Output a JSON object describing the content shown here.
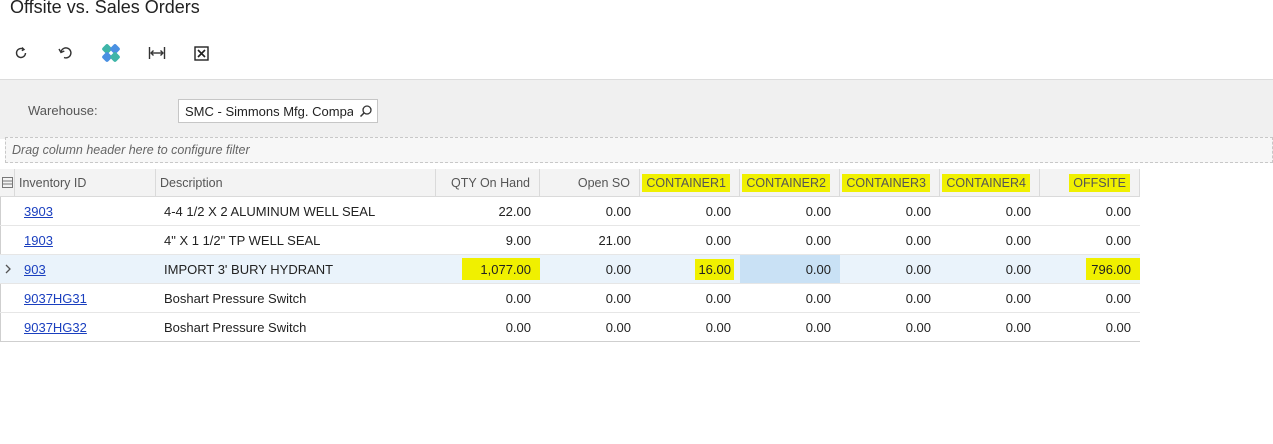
{
  "page": {
    "title": "Offsite vs. Sales Orders"
  },
  "toolbar": {
    "buttons": [
      {
        "name": "refresh-button",
        "icon": "refresh-icon"
      },
      {
        "name": "undo-button",
        "icon": "undo-icon"
      },
      {
        "name": "power-bi-button",
        "icon": "puzzle-icon"
      },
      {
        "name": "fit-columns-button",
        "icon": "fit-width-icon"
      },
      {
        "name": "export-excel-button",
        "icon": "excel-icon"
      }
    ]
  },
  "filter": {
    "warehouse_label": "Warehouse:",
    "warehouse_value": "SMC - Simmons Mfg. Compa"
  },
  "drag_hint": "Drag column header here to configure filter",
  "grid": {
    "columns": [
      {
        "key": "inventory_id",
        "label": "Inventory ID"
      },
      {
        "key": "description",
        "label": "Description"
      },
      {
        "key": "qty_on_hand",
        "label": "QTY On Hand"
      },
      {
        "key": "open_so",
        "label": "Open SO"
      },
      {
        "key": "container1",
        "label": "CONTAINER1"
      },
      {
        "key": "container2",
        "label": "CONTAINER2"
      },
      {
        "key": "container3",
        "label": "CONTAINER3"
      },
      {
        "key": "container4",
        "label": "CONTAINER4"
      },
      {
        "key": "offsite",
        "label": "OFFSITE"
      }
    ],
    "rows": [
      {
        "inventory_id": "3903",
        "description": "4-4 1/2 X 2 ALUMINUM WELL SEAL",
        "qty_on_hand": "22.00",
        "open_so": "0.00",
        "container1": "0.00",
        "container2": "0.00",
        "container3": "0.00",
        "container4": "0.00",
        "offsite": "0.00"
      },
      {
        "inventory_id": "1903",
        "description": "4\" X 1 1/2\" TP WELL SEAL",
        "qty_on_hand": "9.00",
        "open_so": "21.00",
        "container1": "0.00",
        "container2": "0.00",
        "container3": "0.00",
        "container4": "0.00",
        "offsite": "0.00"
      },
      {
        "inventory_id": "903",
        "description": "IMPORT 3' BURY HYDRANT",
        "qty_on_hand": "1,077.00",
        "open_so": "0.00",
        "container1": "16.00",
        "container2": "0.00",
        "container3": "0.00",
        "container4": "0.00",
        "offsite": "796.00"
      },
      {
        "inventory_id": "9037HG31",
        "description": "Boshart Pressure Switch",
        "qty_on_hand": "0.00",
        "open_so": "0.00",
        "container1": "0.00",
        "container2": "0.00",
        "container3": "0.00",
        "container4": "0.00",
        "offsite": "0.00"
      },
      {
        "inventory_id": "9037HG32",
        "description": "Boshart Pressure Switch",
        "qty_on_hand": "0.00",
        "open_so": "0.00",
        "container1": "0.00",
        "container2": "0.00",
        "container3": "0.00",
        "container4": "0.00",
        "offsite": "0.00"
      }
    ]
  },
  "colors": {
    "highlight": "#f0f000",
    "link": "#1a3fbf",
    "selected_row": "#eaf3fb",
    "active_cell": "#c9e1f5"
  }
}
